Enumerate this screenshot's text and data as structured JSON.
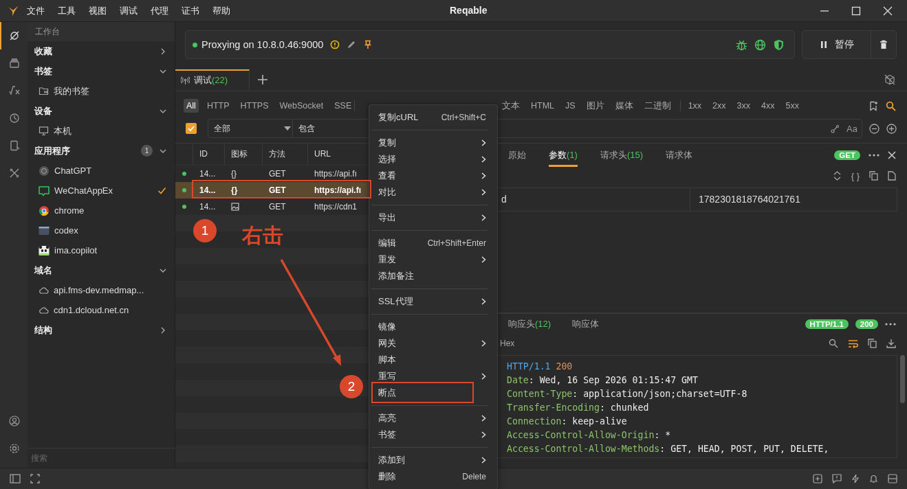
{
  "window": {
    "title": "Reqable"
  },
  "menu_bar": [
    "文件",
    "工具",
    "视图",
    "调试",
    "代理",
    "证书",
    "帮助"
  ],
  "activity_bar": [
    {
      "selected": true
    },
    {
      "selected": false
    },
    {
      "selected": false
    },
    {
      "selected": false
    },
    {
      "selected": false
    },
    {
      "selected": false
    }
  ],
  "sidebar": {
    "heading": "工作台",
    "search": {
      "placeholder": "搜索"
    },
    "sections": [
      {
        "title": "收藏",
        "expanded": false
      },
      {
        "title": "书签",
        "kind": "bookmarks",
        "expanded": true,
        "items": [
          {
            "label": "我的书签",
            "checked": false
          }
        ]
      },
      {
        "title": "设备",
        "kind": "devices",
        "expanded": true,
        "items": [
          {
            "label": "本机",
            "checked": false
          }
        ]
      },
      {
        "title": "应用程序",
        "kind": "apps",
        "expanded": true,
        "count": "1",
        "items": [
          {
            "label": "ChatGPT",
            "checked": false
          },
          {
            "label": "WeChatAppEx",
            "checked": true
          },
          {
            "label": "chrome",
            "checked": false
          },
          {
            "label": "codex",
            "checked": false
          },
          {
            "label": "ima.copilot",
            "checked": false
          }
        ]
      },
      {
        "title": "域名",
        "kind": "domains",
        "expanded": true,
        "items": [
          {
            "label": "api.fms-dev.medmap...",
            "checked": false
          },
          {
            "label": "cdn1.dcloud.net.cn",
            "checked": false
          }
        ]
      },
      {
        "title": "结构",
        "expanded": false
      }
    ]
  },
  "proxy": {
    "status": "Proxying on 10.8.0.46:9000",
    "running": true,
    "pause_label": "暂停"
  },
  "tabs": [
    {
      "label": "调试",
      "count": "(22)",
      "selected": true
    }
  ],
  "filters": [
    [
      {
        "label": "All",
        "selected": true
      },
      {
        "label": "HTTP",
        "selected": false
      },
      {
        "label": "HTTPS",
        "selected": false
      },
      {
        "label": "WebSocket",
        "selected": false
      },
      {
        "label": "SSE",
        "selected": false
      }
    ],
    [
      {
        "label": "文本",
        "selected": false
      },
      {
        "label": "HTML",
        "selected": false
      },
      {
        "label": "JS",
        "selected": false
      },
      {
        "label": "图片",
        "selected": false
      },
      {
        "label": "媒体",
        "selected": false
      },
      {
        "label": "二进制",
        "selected": false
      }
    ],
    [
      {
        "label": "1xx",
        "selected": false
      },
      {
        "label": "2xx",
        "selected": false
      },
      {
        "label": "3xx",
        "selected": false
      },
      {
        "label": "4xx",
        "selected": false
      },
      {
        "label": "5xx",
        "selected": false
      }
    ]
  ],
  "search": {
    "enabled": true,
    "scope": "全部",
    "mode": "包含",
    "case_label": "Aa"
  },
  "table": {
    "columns": [
      "ID",
      "图标",
      "方法",
      "URL"
    ],
    "rows": [
      {
        "id": "14...",
        "kind": "json",
        "icon": "{}",
        "method": "GET",
        "url": "https://api.fı",
        "selected": false
      },
      {
        "id": "14...",
        "kind": "json",
        "icon": "{}",
        "method": "GET",
        "url": "https://api.fı",
        "selected": true
      },
      {
        "id": "14...",
        "kind": "image",
        "method": "GET",
        "url": "https://cdn1",
        "selected": false
      }
    ]
  },
  "request": {
    "tabs": [
      {
        "label": "原始",
        "selected": false
      },
      {
        "label": "参数",
        "count": "(1)",
        "selected": true
      },
      {
        "label": "请求头",
        "count": "(15)",
        "selected": false
      },
      {
        "label": "请求体",
        "selected": false
      }
    ],
    "method_badge": "GET",
    "params": [
      {
        "key": "d",
        "value": "1782301818764021761"
      }
    ]
  },
  "response": {
    "tabs": [
      {
        "label": "响应头",
        "count": "(12)",
        "selected": false
      },
      {
        "label": "响应体",
        "selected": false
      }
    ],
    "protocol_badge": "HTTP/1.1",
    "status_badge": "200",
    "view_label": "Hex",
    "status_line": {
      "protocol": "HTTP/1.1",
      "code": "200"
    },
    "headers": [
      {
        "name": "Date",
        "value": ": Wed, 16 Sep 2026 01:15:47 GMT"
      },
      {
        "name": "Content-Type",
        "value": ": application/json;charset=UTF-8"
      },
      {
        "name": "Transfer-Encoding",
        "value": ": chunked"
      },
      {
        "name": "Connection",
        "value": ": keep-alive"
      },
      {
        "name": "Access-Control-Allow-Origin",
        "value": ": *"
      },
      {
        "name": "Access-Control-Allow-Methods",
        "value": ": GET, HEAD, POST, PUT, DELETE,"
      }
    ]
  },
  "context_menu": [
    {
      "kind": "item",
      "label": "复制cURL",
      "shortcut": "Ctrl+Shift+C",
      "submenu": false
    },
    {
      "kind": "separator"
    },
    {
      "kind": "item",
      "label": "复制",
      "submenu": true
    },
    {
      "kind": "item",
      "label": "选择",
      "submenu": true
    },
    {
      "kind": "item",
      "label": "查看",
      "submenu": true
    },
    {
      "kind": "item",
      "label": "对比",
      "submenu": true
    },
    {
      "kind": "separator"
    },
    {
      "kind": "item",
      "label": "导出",
      "submenu": true
    },
    {
      "kind": "separator"
    },
    {
      "kind": "item",
      "label": "编辑",
      "shortcut": "Ctrl+Shift+Enter",
      "submenu": false
    },
    {
      "kind": "item",
      "label": "重发",
      "submenu": true
    },
    {
      "kind": "item",
      "label": "添加备注",
      "submenu": false
    },
    {
      "kind": "separator"
    },
    {
      "kind": "item",
      "label": "SSL代理",
      "submenu": true
    },
    {
      "kind": "separator"
    },
    {
      "kind": "item",
      "label": "镜像",
      "submenu": false
    },
    {
      "kind": "item",
      "label": "网关",
      "submenu": true
    },
    {
      "kind": "item",
      "label": "脚本",
      "submenu": false
    },
    {
      "kind": "item",
      "label": "重写",
      "submenu": true
    },
    {
      "kind": "item",
      "label": "断点",
      "submenu": false,
      "highlighted": true
    },
    {
      "kind": "separator"
    },
    {
      "kind": "item",
      "label": "高亮",
      "submenu": true
    },
    {
      "kind": "item",
      "label": "书签",
      "submenu": true
    },
    {
      "kind": "separator"
    },
    {
      "kind": "item",
      "label": "添加到",
      "submenu": true
    },
    {
      "kind": "item",
      "label": "删除",
      "shortcut": "Delete",
      "submenu": false
    }
  ],
  "annotations": {
    "steps": [
      "1",
      "2"
    ],
    "note": "右击"
  }
}
